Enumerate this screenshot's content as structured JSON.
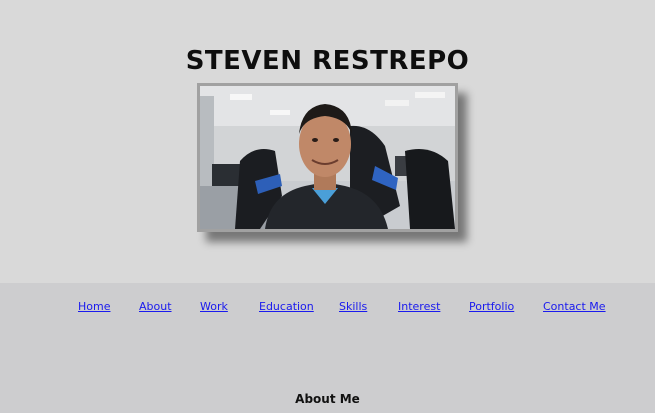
{
  "header": {
    "name": "STEVEN RESTREPO"
  },
  "nav": {
    "items": [
      {
        "label": "Home"
      },
      {
        "label": "About"
      },
      {
        "label": "Work"
      },
      {
        "label": "Education"
      },
      {
        "label": "Skills"
      },
      {
        "label": "Interest"
      },
      {
        "label": "Portfolio"
      },
      {
        "label": "Contact Me"
      }
    ]
  },
  "about": {
    "heading": "About Me"
  },
  "colors": {
    "hero_background": "#d9d9d9",
    "page_background": "#cdcdcf",
    "link": "#1a1aee"
  }
}
